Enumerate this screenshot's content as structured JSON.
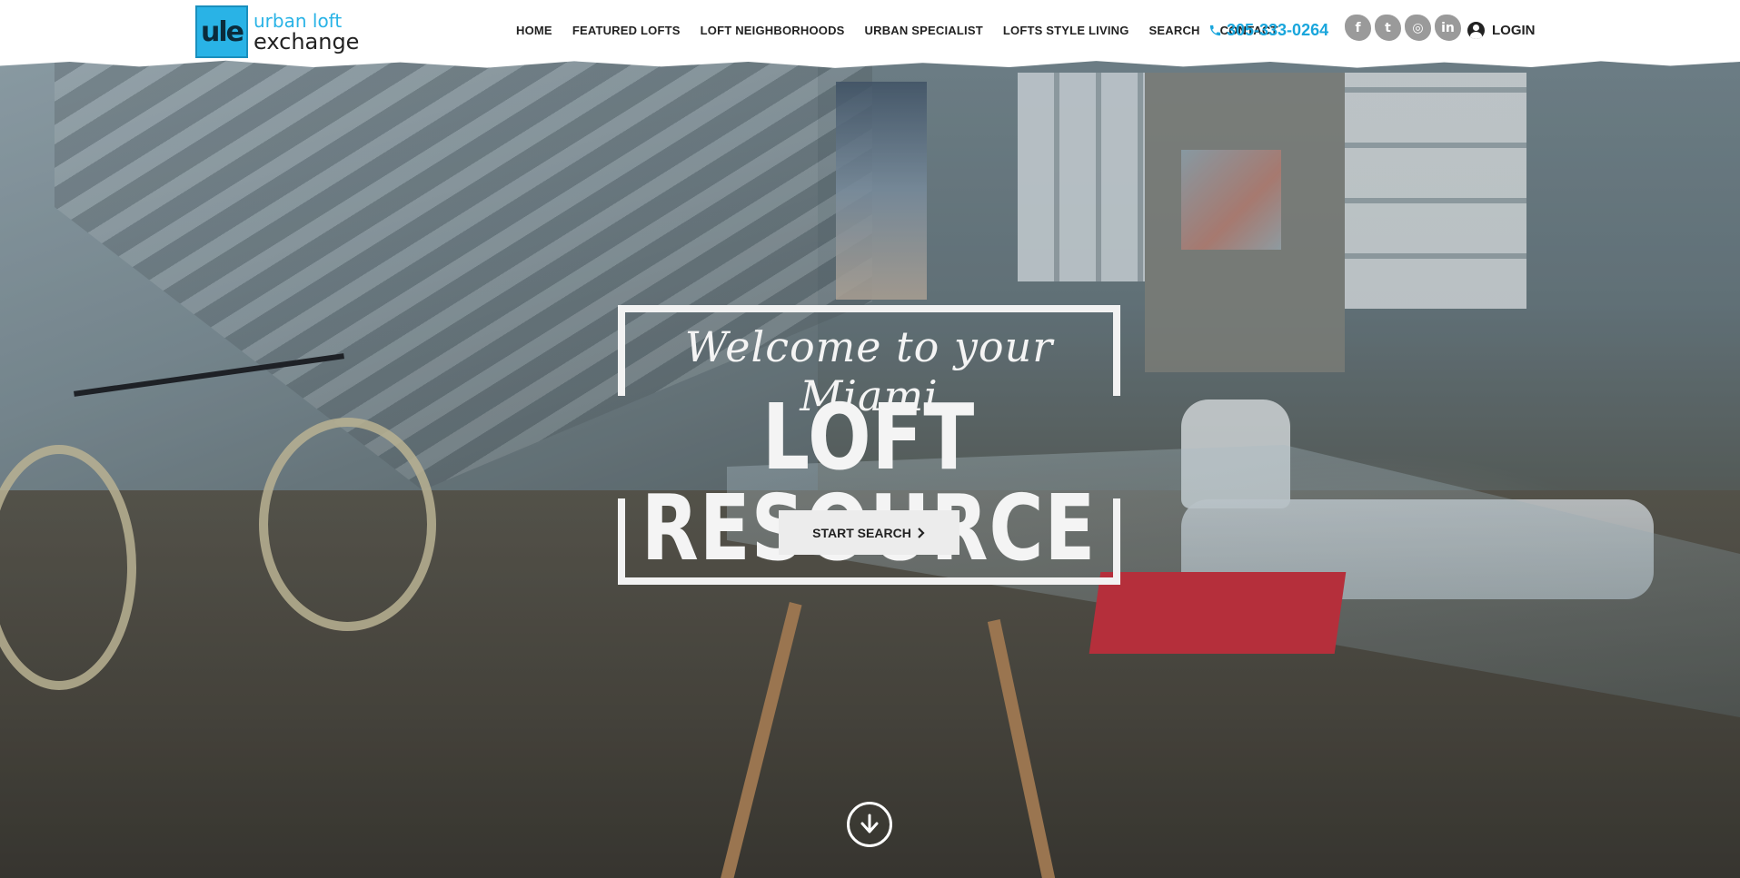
{
  "logo": {
    "mark": "ule",
    "line1": "urban loft",
    "line2": "exchange"
  },
  "nav": [
    {
      "label": "HOME"
    },
    {
      "label": "FEATURED LOFTS"
    },
    {
      "label": "LOFT NEIGHBORHOODS"
    },
    {
      "label": "URBAN SPECIALIST"
    },
    {
      "label": "LOFTS STYLE LIVING"
    },
    {
      "label": "SEARCH"
    },
    {
      "label": "CONTACT"
    }
  ],
  "phone": {
    "number": "305-333-0264",
    "icon": "phone-icon"
  },
  "social": [
    {
      "icon": "facebook-icon",
      "glyph": "f"
    },
    {
      "icon": "twitter-icon",
      "glyph": "t"
    },
    {
      "icon": "instagram-icon",
      "glyph": "◎"
    },
    {
      "icon": "linkedin-icon",
      "glyph": "in"
    }
  ],
  "login": {
    "label": "LOGIN",
    "icon": "user-icon"
  },
  "hero": {
    "welcome": "Welcome to your Miami",
    "headline": "LOFT RESOURCE",
    "cta": "START SEARCH",
    "cta_icon": "chevron-right-icon",
    "scroll_icon": "arrow-down-circle-icon"
  },
  "colors": {
    "accent": "#29b3e6",
    "phone": "#1aa6dc",
    "social": "#9a9a9a"
  }
}
